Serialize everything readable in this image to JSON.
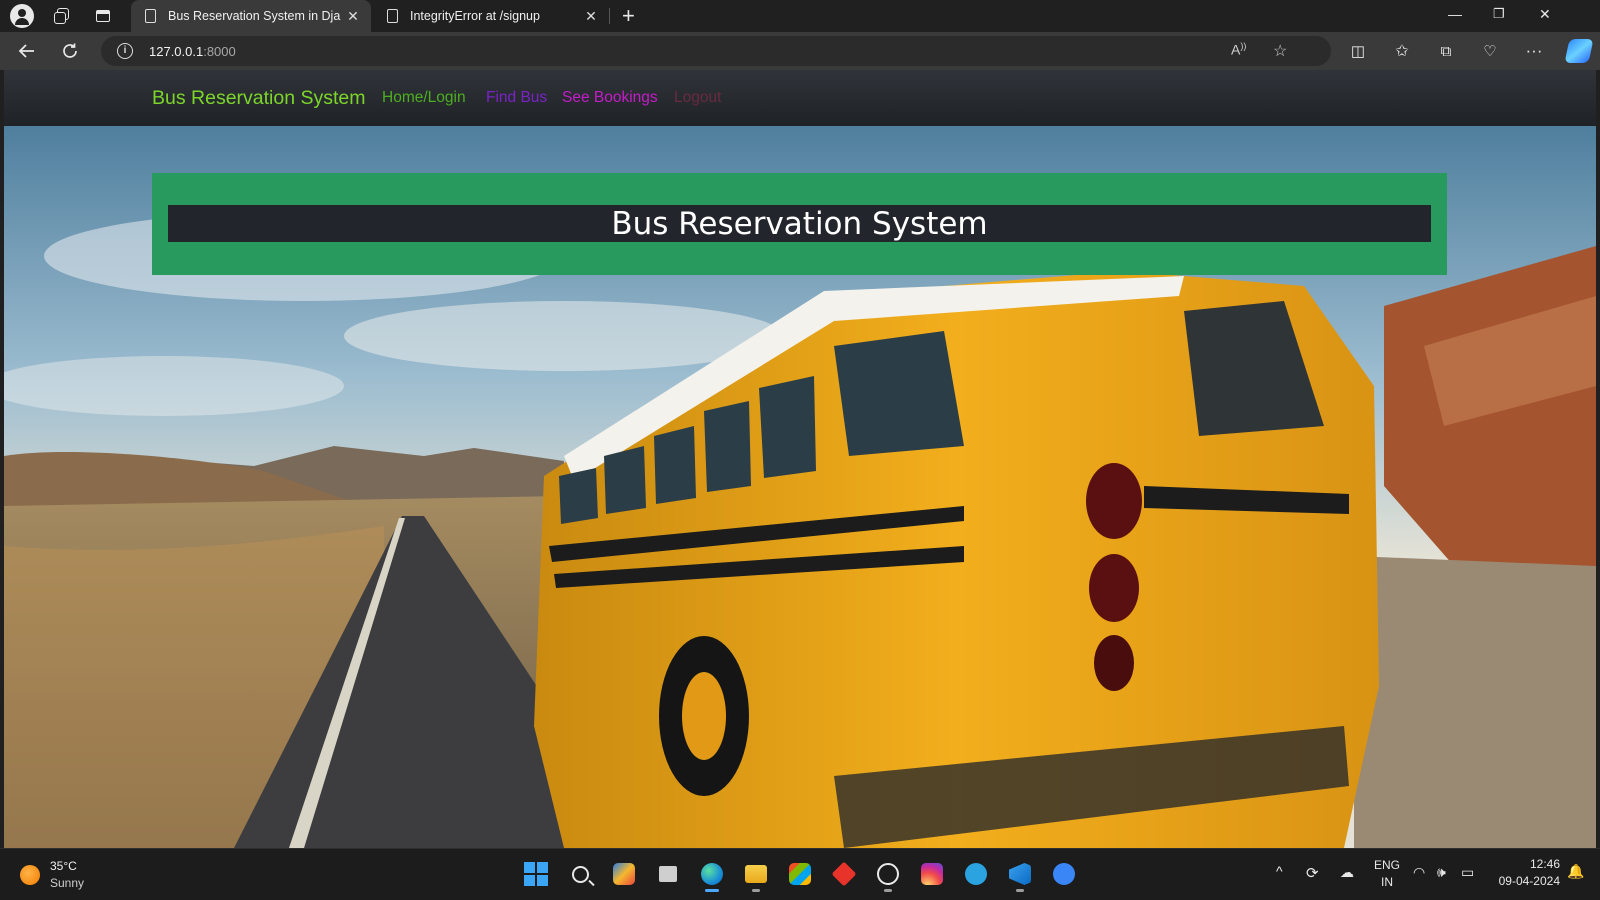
{
  "browser": {
    "tabs": [
      {
        "title": "Bus Reservation System in Djang",
        "active": true
      },
      {
        "title": "IntegrityError at /signup",
        "active": false
      }
    ],
    "url_host": "127.0.0.1",
    "url_port": ":8000",
    "window_controls": {
      "minimize": "—",
      "restore": "❐",
      "close": "✕"
    }
  },
  "navbar": {
    "brand": "Bus Reservation System",
    "links": [
      {
        "label": "Home/Login",
        "color": "#4caf1f"
      },
      {
        "label": "Find Bus",
        "color": "#7b22c9"
      },
      {
        "label": "See Bookings",
        "color": "#c41cc9"
      },
      {
        "label": "Logout",
        "color": "#6a2a3e"
      }
    ]
  },
  "hero": {
    "title": "Bus Reservation System",
    "banner_color": "#289a5e"
  },
  "taskbar": {
    "weather_temp": "35°C",
    "weather_condition": "Sunny",
    "language_top": "ENG",
    "language_bottom": "IN",
    "time": "12:46",
    "date": "09-04-2024",
    "apps": [
      "start",
      "search",
      "widgets",
      "task-view",
      "edge",
      "file-explorer",
      "microsoft-store",
      "git-app",
      "whatsapp",
      "instagram",
      "telegram",
      "vs-code",
      "app-store"
    ]
  }
}
